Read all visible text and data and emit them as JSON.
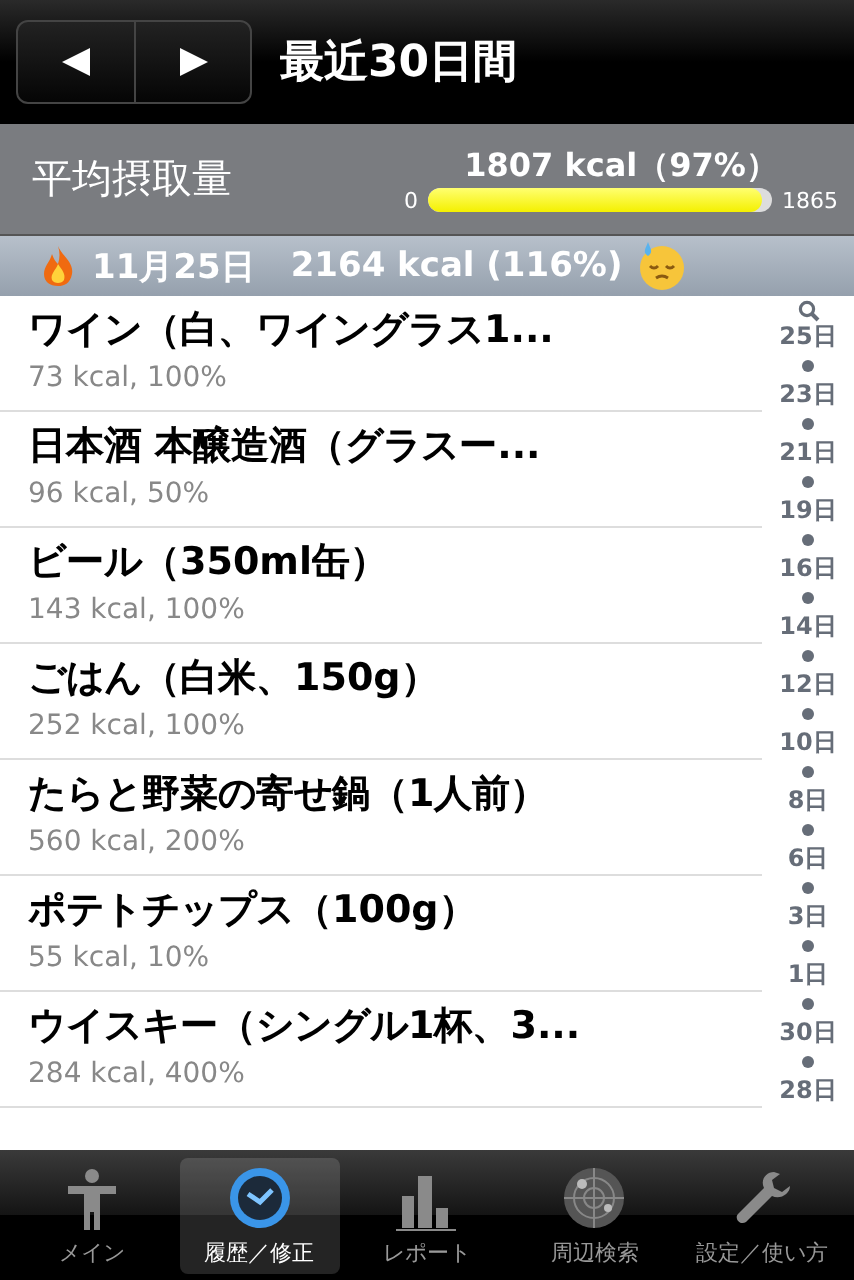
{
  "nav": {
    "title": "最近30日間"
  },
  "summary": {
    "label": "平均摂取量",
    "value": "1807 kcal（97%）",
    "min": "0",
    "max": "1865",
    "level": 0.97
  },
  "section": {
    "date": "11月25日",
    "total": "2164 kcal (116%)"
  },
  "items": [
    {
      "name": "ワイン（白、ワイングラス1...",
      "detail": "73 kcal, 100%"
    },
    {
      "name": "日本酒 本醸造酒（グラスー...",
      "detail": "96 kcal, 50%"
    },
    {
      "name": "ビール（350ml缶）",
      "detail": "143 kcal, 100%"
    },
    {
      "name": "ごはん（白米、150g）",
      "detail": "252 kcal, 100%"
    },
    {
      "name": "たらと野菜の寄せ鍋（1人前）",
      "detail": "560 kcal, 200%"
    },
    {
      "name": "ポテトチップス（100g）",
      "detail": "55 kcal, 10%"
    },
    {
      "name": "ウイスキー（シングル1杯、3...",
      "detail": "284 kcal, 400%"
    }
  ],
  "index": [
    "25日",
    "23日",
    "21日",
    "19日",
    "16日",
    "14日",
    "12日",
    "10日",
    "8日",
    "6日",
    "3日",
    "1日",
    "30日",
    "28日"
  ],
  "tabs": [
    {
      "label": "メイン",
      "selected": false
    },
    {
      "label": "履歴／修正",
      "selected": true
    },
    {
      "label": "レポート",
      "selected": false
    },
    {
      "label": "周辺検索",
      "selected": false
    },
    {
      "label": "設定／使い方",
      "selected": false
    }
  ]
}
